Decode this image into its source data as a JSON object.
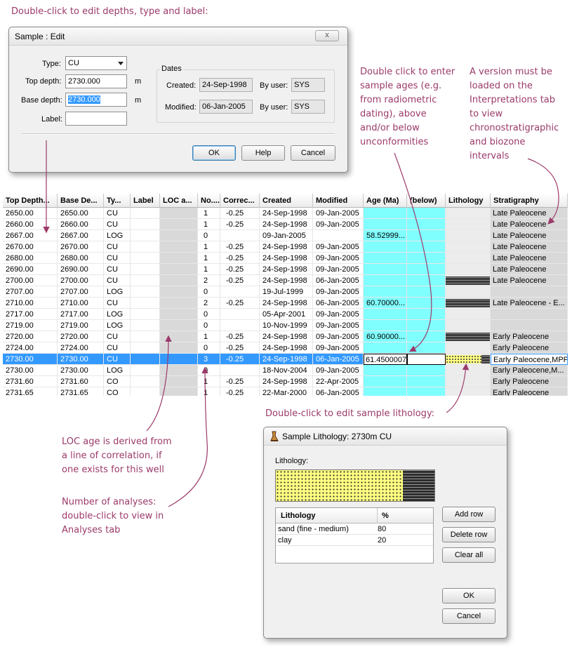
{
  "annotations": {
    "edit_sample": "Double-click to edit depths, type and label:",
    "sample_ages": "Double click to enter\nsample ages (e.g.\nfrom radiometric\ndating), above\nand/or below\nunconformities",
    "version": "A version must be\nloaded on the\nInterpretations tab\nto view\nchronostratigraphic\nand biozone\nintervals",
    "loc_age": "LOC age is derived from\na line of correlation, if\none exists for this well",
    "analyses": "Number of analyses:\ndouble-click to view in\nAnalyses tab",
    "edit_lithology": "Double-click to edit sample lithology:"
  },
  "sample_dialog": {
    "title": "Sample : Edit",
    "close_label": "x",
    "type_label": "Type:",
    "type_value": "CU",
    "top_depth_label": "Top depth:",
    "top_depth_value": "2730.000",
    "base_depth_label": "Base depth:",
    "base_depth_value": "2730.000",
    "unit": "m",
    "label_label": "Label:",
    "label_value": "",
    "dates_title": "Dates",
    "created_label": "Created:",
    "created_value": "24-Sep-1998",
    "modified_label": "Modified:",
    "modified_value": "06-Jan-2005",
    "by_user_label": "By user:",
    "created_by": "SYS",
    "modified_by": "SYS",
    "ok": "OK",
    "help": "Help",
    "cancel": "Cancel"
  },
  "table": {
    "headers": [
      "Top Depth...",
      "Base De...",
      "Ty...",
      "Label",
      "LOC a...",
      "No....",
      "Correc...",
      "Created",
      "Modified",
      "Age (Ma)",
      "(below)",
      "Lithology",
      "Stratigraphy"
    ],
    "rows": [
      {
        "top": "2650.00",
        "base": "2650.00",
        "type": "CU",
        "label": "",
        "loc": "",
        "no": "1",
        "corr": "-0.25",
        "created": "24-Sep-1998",
        "modified": "09-Jan-2005",
        "age": "",
        "below": "",
        "lith": "",
        "strat": "Late Paleocene"
      },
      {
        "top": "2660.00",
        "base": "2660.00",
        "type": "CU",
        "label": "",
        "loc": "",
        "no": "1",
        "corr": "-0.25",
        "created": "24-Sep-1998",
        "modified": "09-Jan-2005",
        "age": "",
        "below": "",
        "lith": "",
        "strat": "Late Paleocene"
      },
      {
        "top": "2667.00",
        "base": "2667.00",
        "type": "LOG",
        "label": "",
        "loc": "",
        "no": "0",
        "corr": "",
        "created": "09-Jan-2005",
        "modified": "",
        "age": "58.52999...",
        "below": "",
        "lith": "",
        "strat": "Late Paleocene"
      },
      {
        "top": "2670.00",
        "base": "2670.00",
        "type": "CU",
        "label": "",
        "loc": "",
        "no": "1",
        "corr": "-0.25",
        "created": "24-Sep-1998",
        "modified": "09-Jan-2005",
        "age": "",
        "below": "",
        "lith": "",
        "strat": "Late Paleocene"
      },
      {
        "top": "2680.00",
        "base": "2680.00",
        "type": "CU",
        "label": "",
        "loc": "",
        "no": "1",
        "corr": "-0.25",
        "created": "24-Sep-1998",
        "modified": "09-Jan-2005",
        "age": "",
        "below": "",
        "lith": "",
        "strat": "Late Paleocene"
      },
      {
        "top": "2690.00",
        "base": "2690.00",
        "type": "CU",
        "label": "",
        "loc": "",
        "no": "1",
        "corr": "-0.25",
        "created": "24-Sep-1998",
        "modified": "09-Jan-2005",
        "age": "",
        "below": "",
        "lith": "",
        "strat": "Late Paleocene"
      },
      {
        "top": "2700.00",
        "base": "2700.00",
        "type": "CU",
        "label": "",
        "loc": "",
        "no": "2",
        "corr": "-0.25",
        "created": "24-Sep-1998",
        "modified": "06-Jan-2005",
        "age": "",
        "below": "",
        "lith": "shale",
        "strat": "Late Paleocene"
      },
      {
        "top": "2707.00",
        "base": "2707.00",
        "type": "LOG",
        "label": "",
        "loc": "",
        "no": "0",
        "corr": "",
        "created": "19-Jul-1999",
        "modified": "09-Jan-2005",
        "age": "",
        "below": "",
        "lith": "",
        "strat": ""
      },
      {
        "top": "2710.00",
        "base": "2710.00",
        "type": "CU",
        "label": "",
        "loc": "",
        "no": "2",
        "corr": "-0.25",
        "created": "24-Sep-1998",
        "modified": "06-Jan-2005",
        "age": "60.70000...",
        "below": "",
        "lith": "shale",
        "strat": "Late Paleocene - E..."
      },
      {
        "top": "2717.00",
        "base": "2717.00",
        "type": "LOG",
        "label": "",
        "loc": "",
        "no": "0",
        "corr": "",
        "created": "05-Apr-2001",
        "modified": "09-Jan-2005",
        "age": "",
        "below": "",
        "lith": "",
        "strat": ""
      },
      {
        "top": "2719.00",
        "base": "2719.00",
        "type": "LOG",
        "label": "",
        "loc": "",
        "no": "0",
        "corr": "",
        "created": "10-Nov-1999",
        "modified": "09-Jan-2005",
        "age": "",
        "below": "",
        "lith": "",
        "strat": ""
      },
      {
        "top": "2720.00",
        "base": "2720.00",
        "type": "CU",
        "label": "",
        "loc": "",
        "no": "1",
        "corr": "-0.25",
        "created": "24-Sep-1998",
        "modified": "09-Jan-2005",
        "age": "60.90000...",
        "below": "",
        "lith": "shale",
        "strat": "Early Paleocene"
      },
      {
        "top": "2724.00",
        "base": "2724.00",
        "type": "CU",
        "label": "",
        "loc": "",
        "no": "0",
        "corr": "-0.25",
        "created": "24-Sep-1998",
        "modified": "09-Jan-2005",
        "age": "",
        "below": "",
        "lith": "",
        "strat": "Early Paleocene"
      },
      {
        "top": "2730.00",
        "base": "2730.00",
        "type": "CU",
        "label": "",
        "loc": "",
        "no": "3",
        "corr": "-0.25",
        "created": "24-Sep-1998",
        "modified": "06-Jan-2005",
        "age": "61.4500007",
        "below": "",
        "lith": "sand-shale",
        "strat": "Early Paleocene,MPP2",
        "selected": true
      },
      {
        "top": "2730.00",
        "base": "2730.00",
        "type": "LOG",
        "label": "",
        "loc": "",
        "no": "0",
        "corr": "",
        "created": "18-Nov-2004",
        "modified": "09-Jan-2005",
        "age": "",
        "below": "",
        "lith": "",
        "strat": "Early Paleocene,M..."
      },
      {
        "top": "2731.60",
        "base": "2731.60",
        "type": "CO",
        "label": "",
        "loc": "",
        "no": "1",
        "corr": "-0.25",
        "created": "24-Sep-1998",
        "modified": "22-Apr-2005",
        "age": "",
        "below": "",
        "lith": "",
        "strat": "Early Paleocene"
      },
      {
        "top": "2731.65",
        "base": "2731.65",
        "type": "CO",
        "label": "",
        "loc": "",
        "no": "1",
        "corr": "-0.25",
        "created": "22-Mar-2000",
        "modified": "06-Jan-2005",
        "age": "",
        "below": "",
        "lith": "",
        "strat": "Early Paleocene"
      }
    ]
  },
  "lith_dialog": {
    "title": "Sample Lithology: 2730m CU",
    "icon": "lithology-sample-icon",
    "section_label": "Lithology:",
    "col_lithology": "Lithology",
    "col_percent": "%",
    "entries": [
      {
        "name": "sand (fine - medium)",
        "percent": "80"
      },
      {
        "name": "clay",
        "percent": "20"
      }
    ],
    "add_row": "Add row",
    "delete_row": "Delete row",
    "clear_all": "Clear all",
    "ok": "OK",
    "cancel": "Cancel"
  },
  "colors": {
    "annotation": "#9b3a6a",
    "age_cell": "#80ffff",
    "selection": "#3399ff",
    "sand": "#ffff80"
  }
}
